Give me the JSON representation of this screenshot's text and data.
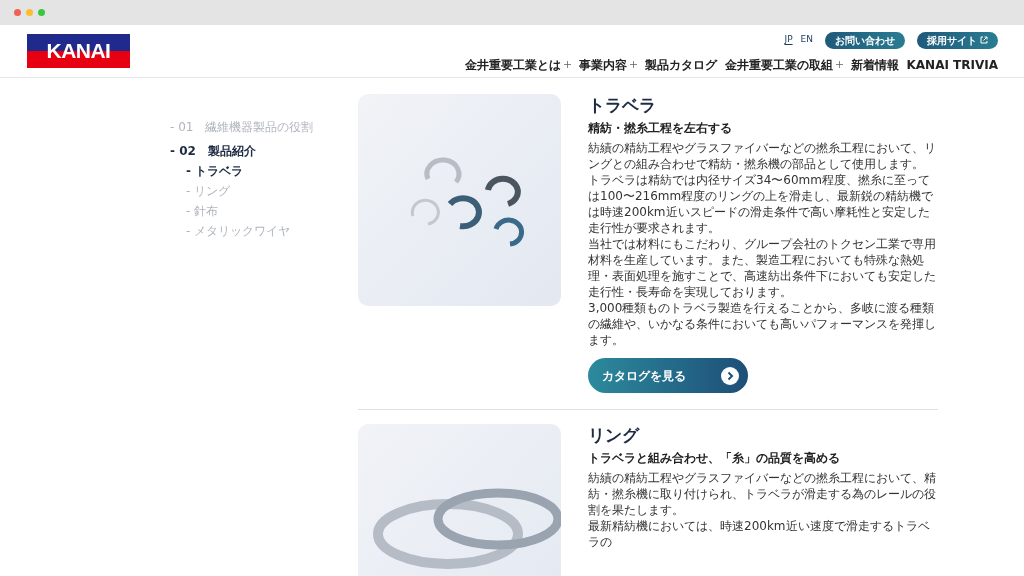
{
  "header": {
    "logo": "KANAI",
    "languages": [
      {
        "label": "JP",
        "selected": true
      },
      {
        "label": "EN",
        "selected": false
      }
    ],
    "buttons": [
      {
        "label": "お問い合わせ",
        "external": false
      },
      {
        "label": "採用サイト",
        "external": true
      }
    ],
    "nav": [
      {
        "label": "金井重要工業とは",
        "has_submenu": true
      },
      {
        "label": "事業内容",
        "has_submenu": true
      },
      {
        "label": "製品カタログ",
        "has_submenu": false
      },
      {
        "label": "金井重要工業の取組",
        "has_submenu": true
      },
      {
        "label": "新着情報",
        "has_submenu": false
      },
      {
        "label": "KANAI TRIVIA",
        "has_submenu": false
      }
    ]
  },
  "toc": [
    {
      "label": "- 01　繊維機器製品の役割",
      "selected": false
    },
    {
      "label": "- 02　製品紹介",
      "selected": true,
      "children": [
        {
          "label": "- トラベラ",
          "selected": true
        },
        {
          "label": "- リング",
          "selected": false
        },
        {
          "label": "- 針布",
          "selected": false
        },
        {
          "label": "- メタリックワイヤ",
          "selected": false
        }
      ]
    }
  ],
  "products": [
    {
      "title": "トラベラ",
      "subtitle": "精紡・撚糸工程を左右する",
      "paragraphs": [
        "紡績の精紡工程やグラスファイバーなどの撚糸工程において、リングとの組み合わせで精紡・撚糸機の部品として使用します。",
        "トラベラは精紡では内径サイズ34〜60mm程度、撚糸に至っては100〜216mm程度のリングの上を滑走し、最新鋭の精紡機では時速200km近いスピードの滑走条件で高い摩耗性と安定した走行性が要求されます。",
        "当社では材料にもこだわり、グループ会社のトクセン工業で専用材料を生産しています。また、製造工程においても特殊な熱処理・表面処理を施すことで、高速紡出条件下においても安定した走行性・長寿命を実現しております。",
        "3,000種類ものトラベラ製造を行えることから、多岐に渡る種類の繊維や、いかなる条件においても高いパフォーマンスを発揮します。"
      ],
      "button": "カタログを見る"
    },
    {
      "title": "リング",
      "subtitle": "トラベラと組み合わせ、「糸」の品質を高める",
      "paragraphs": [
        "紡績の精紡工程やグラスファイバーなどの撚糸工程において、精紡・撚糸機に取り付けられ、トラベラが滑走する為のレールの役割を果たします。",
        "最新精紡機においては、時速200km近い速度で滑走するトラベラの"
      ]
    }
  ]
}
